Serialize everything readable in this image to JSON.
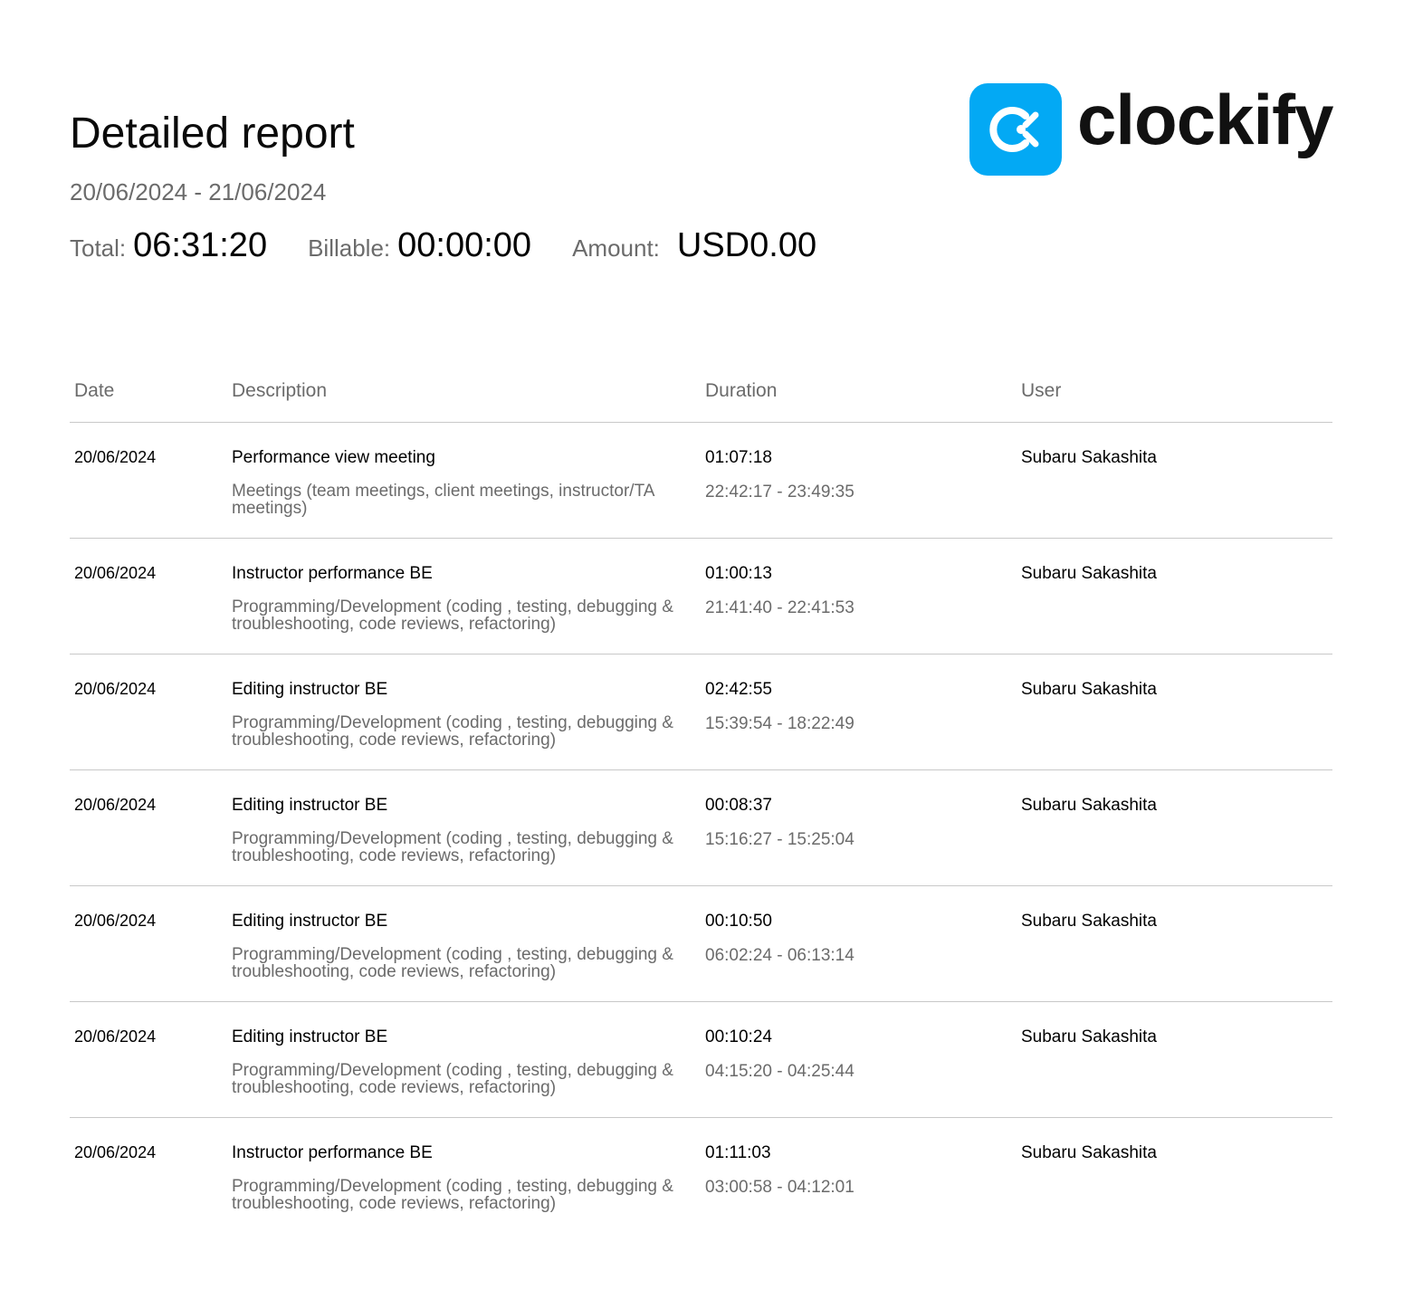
{
  "report": {
    "title": "Detailed report",
    "date_range": "20/06/2024 - 21/06/2024",
    "summary": {
      "total_label": "Total:",
      "total_value": "06:31:20",
      "billable_label": "Billable:",
      "billable_value": "00:00:00",
      "amount_label": "Amount:",
      "amount_value": "USD0.00"
    }
  },
  "brand": {
    "name": "clockify",
    "icon": "clockify-logo-icon",
    "accent_color": "#03A9F4"
  },
  "table": {
    "headers": {
      "date": "Date",
      "description": "Description",
      "duration": "Duration",
      "user": "User"
    },
    "rows": [
      {
        "date": "20/06/2024",
        "description": "Performance view meeting",
        "project": "Meetings (team meetings, client meetings, instructor/TA meetings)",
        "duration": "01:07:18",
        "time_range": "22:42:17 - 23:49:35",
        "user": "Subaru Sakashita"
      },
      {
        "date": "20/06/2024",
        "description": "Instructor performance BE",
        "project": "Programming/Development (coding , testing, debugging & troubleshooting, code reviews, refactoring)",
        "duration": "01:00:13",
        "time_range": "21:41:40 - 22:41:53",
        "user": "Subaru Sakashita"
      },
      {
        "date": "20/06/2024",
        "description": "Editing instructor BE",
        "project": "Programming/Development (coding , testing, debugging & troubleshooting, code reviews, refactoring)",
        "duration": "02:42:55",
        "time_range": "15:39:54 - 18:22:49",
        "user": "Subaru Sakashita"
      },
      {
        "date": "20/06/2024",
        "description": "Editing instructor BE",
        "project": "Programming/Development (coding , testing, debugging & troubleshooting, code reviews, refactoring)",
        "duration": "00:08:37",
        "time_range": "15:16:27 - 15:25:04",
        "user": "Subaru Sakashita"
      },
      {
        "date": "20/06/2024",
        "description": "Editing instructor BE",
        "project": "Programming/Development (coding , testing, debugging & troubleshooting, code reviews, refactoring)",
        "duration": "00:10:50",
        "time_range": "06:02:24 - 06:13:14",
        "user": "Subaru Sakashita"
      },
      {
        "date": "20/06/2024",
        "description": "Editing instructor BE",
        "project": "Programming/Development (coding , testing, debugging & troubleshooting, code reviews, refactoring)",
        "duration": "00:10:24",
        "time_range": "04:15:20 - 04:25:44",
        "user": "Subaru Sakashita"
      },
      {
        "date": "20/06/2024",
        "description": "Instructor performance BE",
        "project": "Programming/Development (coding , testing, debugging & troubleshooting, code reviews, refactoring)",
        "duration": "01:11:03",
        "time_range": "03:00:58 - 04:12:01",
        "user": "Subaru Sakashita"
      }
    ]
  }
}
